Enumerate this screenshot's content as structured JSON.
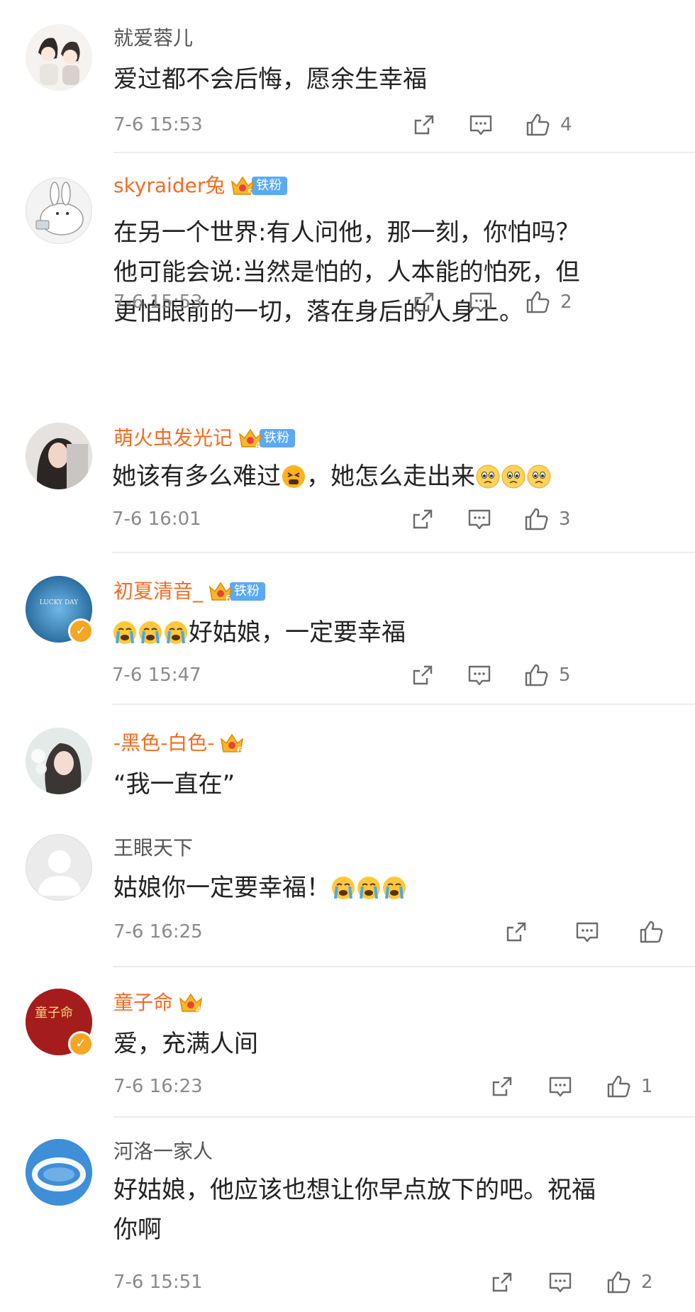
{
  "comments": [
    {
      "username": "就爱蓉儿",
      "name_style": "plain",
      "text": "爱过都不会后悔，愿余生幸福",
      "time": "7-6 15:53",
      "likes": "4",
      "avatar": "couple-cartoon"
    },
    {
      "username": "skyraider兔",
      "name_style": "vip",
      "crown_level": "5",
      "fan_badge": "铁粉",
      "text": "在另一个世界:有人问他，那一刻，你怕吗？他可能会说:当然是怕的，人本能的怕死，但更怕眼前的一切，落在身后的人身上。",
      "time": "7-6 15:53",
      "likes": "2",
      "avatar": "white-rabbit"
    },
    {
      "username": "萌火虫发光记",
      "name_style": "vip",
      "crown_level": "4",
      "fan_badge": "铁粉",
      "text_before": "她该有多么难过",
      "text_after": "，她怎么走出来",
      "emojis_mid": [
        "tired-face-emoji"
      ],
      "emojis_end": [
        "sad-face-emoji",
        "sad-face-emoji",
        "sad-face-emoji"
      ],
      "time": "7-6 16:01",
      "likes": "3",
      "avatar": "girl-photo"
    },
    {
      "username": "初夏清音_",
      "name_style": "vip",
      "crown_level": "6",
      "fan_badge": "铁粉",
      "text": "好姑娘，一定要幸福",
      "emojis_start": [
        "crying-face-emoji",
        "crying-face-emoji",
        "crying-face-emoji"
      ],
      "time": "7-6 15:47",
      "likes": "5",
      "avatar": "lucky-day",
      "avatar_text": "LUCKY DAY",
      "verified": true
    },
    {
      "username": "-黑色-白色-",
      "name_style": "vip",
      "crown_level": "6",
      "text": "“我一直在”",
      "avatar": "girl-flower-photo"
    },
    {
      "username": "王眼天下",
      "name_style": "plain",
      "text": "姑娘你一定要幸福！",
      "emojis_end": [
        "crying-face-emoji",
        "crying-face-emoji",
        "crying-face-emoji"
      ],
      "time": "7-6 16:25",
      "likes": "",
      "avatar": "default-gray"
    },
    {
      "username": "童子命",
      "name_style": "vip",
      "crown_level": "4",
      "text": "爱，充满人间",
      "time": "7-6 16:23",
      "likes": "1",
      "avatar": "red-calligraphy",
      "avatar_text": "童子命",
      "verified": true
    },
    {
      "username": "河洛一家人",
      "name_style": "plain",
      "text": "好姑娘，他应该也想让你早点放下的吧。祝福你啊",
      "time": "7-6 15:51",
      "likes": "2",
      "avatar": "cloud-blue"
    }
  ],
  "colors": {
    "vip_name": "#f36c24",
    "badge_blue": "#5aa9f5",
    "crown_gold": "#f5b829",
    "crown_red": "#e8423a",
    "verified_orange": "#f5a623"
  },
  "icons": {
    "share": "share-icon",
    "comment": "comment-icon",
    "like": "thumbs-up-icon"
  }
}
